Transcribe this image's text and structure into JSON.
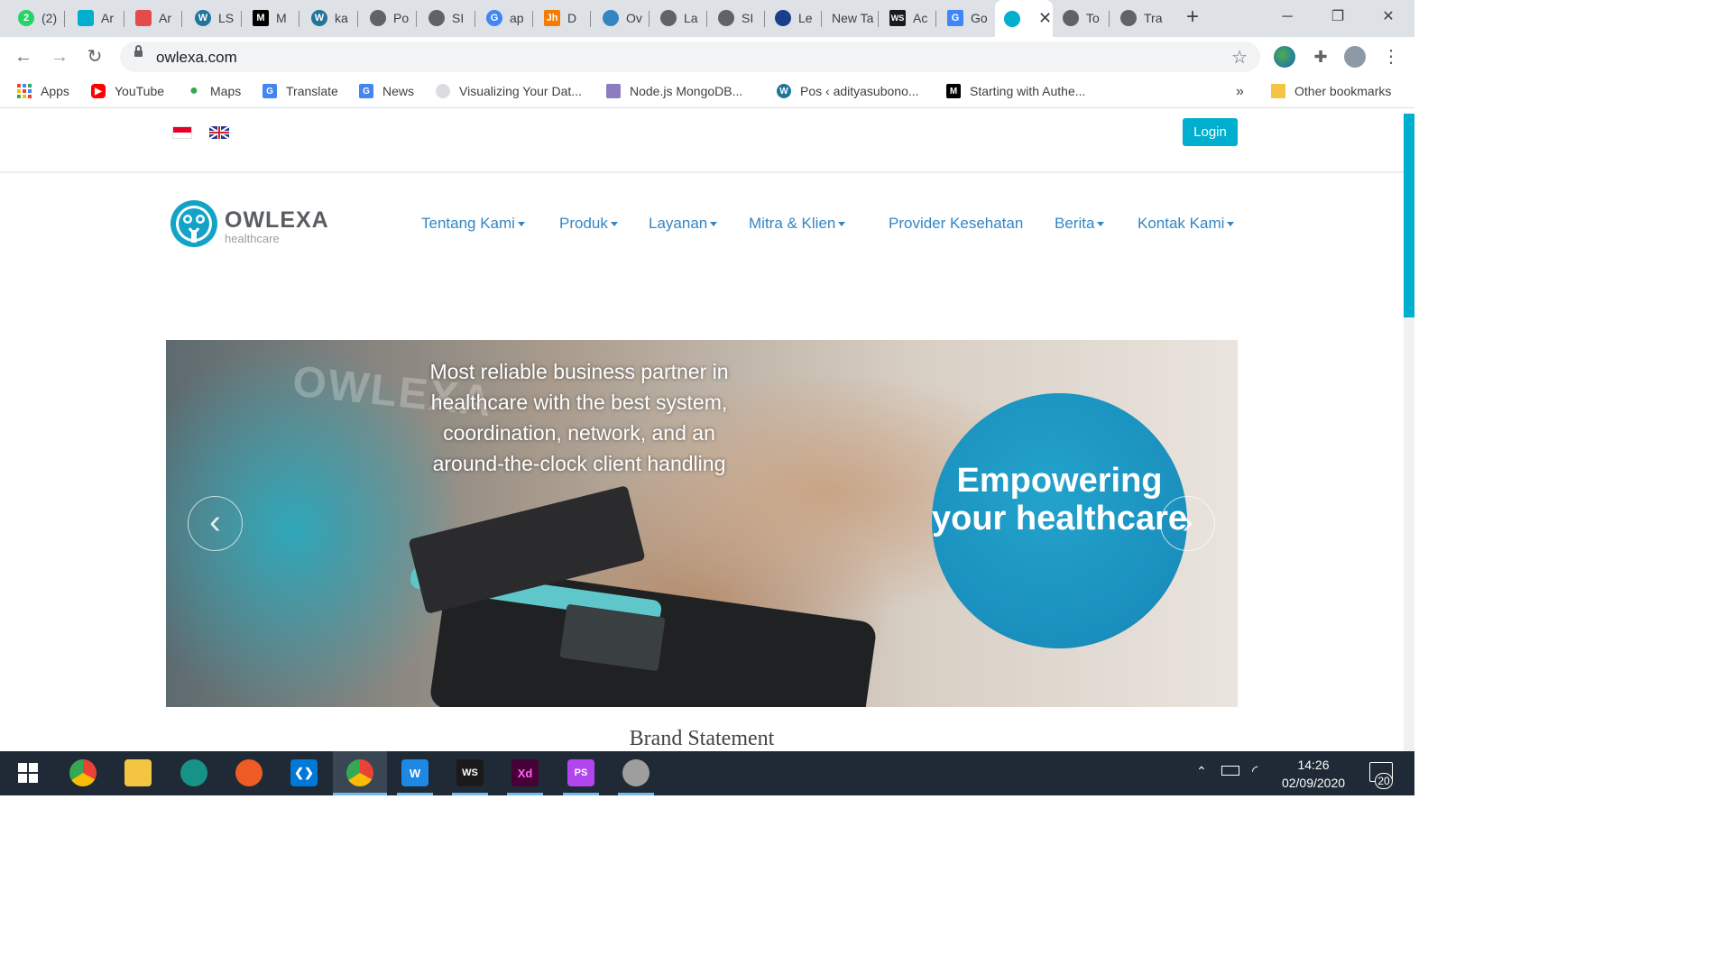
{
  "browser": {
    "tabs": [
      {
        "label": "(2)",
        "color": "#25d366",
        "icon": "whatsapp-icon"
      },
      {
        "label": "Ar",
        "color": "#00aecd",
        "icon": "bird-icon"
      },
      {
        "label": "Ar",
        "color": "#e44c4c",
        "icon": "laravel-icon"
      },
      {
        "label": "LS",
        "color": "#21759b",
        "icon": "wordpress-icon"
      },
      {
        "label": "M",
        "color": "#000000",
        "icon": "medium-icon"
      },
      {
        "label": "ka",
        "color": "#21759b",
        "icon": "wordpress-icon"
      },
      {
        "label": "Po",
        "color": "#5f6368",
        "icon": "globe-icon"
      },
      {
        "label": "SI",
        "color": "#5f6368",
        "icon": "globe-icon"
      },
      {
        "label": "ap",
        "color": "#4285f4",
        "icon": "google-icon"
      },
      {
        "label": "D",
        "color": "#f57c00",
        "icon": "jh-icon"
      },
      {
        "label": "Ov",
        "color": "#3486c3",
        "icon": "owlexa-icon"
      },
      {
        "label": "La",
        "color": "#5f6368",
        "icon": "globe-icon"
      },
      {
        "label": "SI",
        "color": "#5f6368",
        "icon": "globe-icon"
      },
      {
        "label": "Le",
        "color": "#1a3e8c",
        "icon": "university-icon"
      },
      {
        "label": "New Ta",
        "color": "",
        "icon": ""
      },
      {
        "label": "Ac",
        "color": "#1a1a1a",
        "icon": "webstorm-icon"
      },
      {
        "label": "Go",
        "color": "#4285f4",
        "icon": "translate-icon"
      },
      {
        "label": "",
        "color": "#00aecd",
        "icon": "owlexa-icon",
        "active": true
      },
      {
        "label": "To",
        "color": "#5f6368",
        "icon": "globe-icon"
      },
      {
        "label": "Tra",
        "color": "#5f6368",
        "icon": "globe-icon"
      }
    ],
    "new_tab": "+",
    "window_controls": {
      "minimize": "─",
      "restore": "❐",
      "close": "✕"
    },
    "url": "owlexa.com",
    "bookmarks": [
      {
        "label": "Apps",
        "icon": "apps-grid-icon",
        "color": "#ea4335"
      },
      {
        "label": "YouTube",
        "icon": "youtube-icon",
        "color": "#ff0000"
      },
      {
        "label": "Maps",
        "icon": "maps-pin-icon",
        "color": "#34a853"
      },
      {
        "label": "Translate",
        "icon": "translate-icon",
        "color": "#4285f4"
      },
      {
        "label": "News",
        "icon": "news-icon",
        "color": "#4285f4"
      },
      {
        "label": "Visualizing Your Dat...",
        "icon": "globe-icon",
        "color": "#9aa0a6"
      },
      {
        "label": "Node.js MongoDB...",
        "icon": "node-icon",
        "color": "#8e7cc3"
      },
      {
        "label": "Pos ‹ adityasubono...",
        "icon": "wordpress-icon",
        "color": "#21759b"
      },
      {
        "label": "Starting with Authe...",
        "icon": "medium-icon",
        "color": "#000000"
      }
    ],
    "bookmarks_overflow": "»",
    "other_bookmarks": "Other bookmarks"
  },
  "site": {
    "login": "Login",
    "logo": {
      "name": "OWLEXA",
      "tagline": "healthcare"
    },
    "nav": [
      {
        "label": "Tentang Kami",
        "dropdown": true
      },
      {
        "label": "Produk",
        "dropdown": true
      },
      {
        "label": "Layanan",
        "dropdown": true
      },
      {
        "label": "Mitra & Klien",
        "dropdown": true
      },
      {
        "label": "Provider Kesehatan",
        "dropdown": false
      },
      {
        "label": "Berita",
        "dropdown": true
      },
      {
        "label": "Kontak Kami",
        "dropdown": true
      }
    ],
    "hero": {
      "caption": "Most reliable business partner in healthcare with the best system, coordination, network, and an around-the-clock client handling",
      "circle_text": "Empowering your healthcare",
      "background_text": "OWLEXA",
      "prev": "‹",
      "next": "›"
    },
    "brand_statement": "Brand Statement",
    "accent_color": "#00aecd",
    "nav_color": "#3486c3"
  },
  "taskbar": {
    "apps": [
      {
        "name": "chrome",
        "icon": "chrome-icon",
        "color": "#4285f4"
      },
      {
        "name": "file-explorer",
        "icon": "folder-icon",
        "color": "#f4c542"
      },
      {
        "name": "gitkraken",
        "icon": "gitkraken-icon",
        "color": "#179287"
      },
      {
        "name": "postman",
        "icon": "postman-icon",
        "color": "#ef5b25"
      },
      {
        "name": "vscode",
        "icon": "vscode-icon",
        "color": "#0078d7"
      },
      {
        "name": "chrome-profile",
        "icon": "chrome-icon",
        "color": "#4285f4"
      },
      {
        "name": "wps",
        "icon": "wps-icon",
        "color": "#1e88e5"
      },
      {
        "name": "webstorm",
        "icon": "webstorm-icon",
        "color": "#1a1a1a"
      },
      {
        "name": "adobe-xd",
        "icon": "xd-icon",
        "color": "#470137"
      },
      {
        "name": "phpstorm",
        "icon": "phpstorm-icon",
        "color": "#b345f1"
      },
      {
        "name": "paint",
        "icon": "paint-icon",
        "color": "#9e9e9e"
      }
    ],
    "time": "14:26",
    "date": "02/09/2020",
    "notifications": "20"
  }
}
